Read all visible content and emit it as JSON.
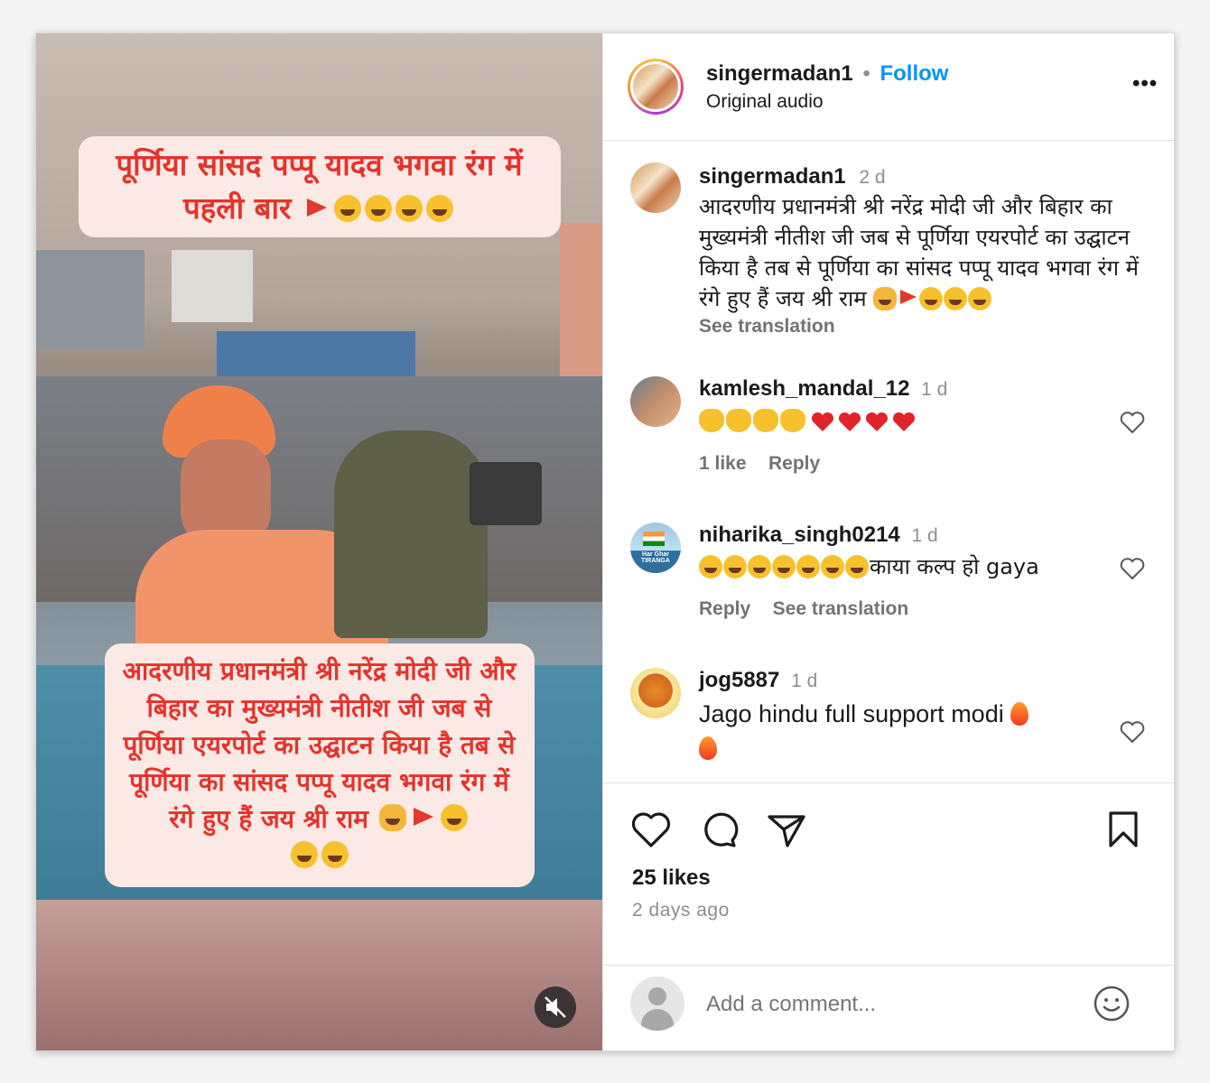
{
  "media": {
    "caption_top": "पूर्णिया सांसद पप्पू यादव भगवा रंग में पहली बार",
    "caption_bottom": "आदरणीय प्रधानमंत्री श्री नरेंद्र मोदी जी और बिहार का मुख्यमंत्री नीतीश जी जब से पूर्णिया एयरपोर्ट का उद्घाटन किया है तब से पूर्णिया का सांसद पप्पू यादव भगवा रंग में रंगे हुए हैं जय श्री राम",
    "mute_icon": "muted-speaker-icon"
  },
  "header": {
    "username": "singermadan1",
    "separator": "•",
    "follow_label": "Follow",
    "audio_label": "Original audio",
    "more_icon": "•••"
  },
  "post": {
    "username": "singermadan1",
    "time": "2 d",
    "text": "आदरणीय प्रधानमंत्री श्री नरेंद्र मोदी जी और बिहार का मुख्यमंत्री नीतीश जी जब से पूर्णिया एयरपोर्ट का उद्घाटन किया है तब से पूर्णिया का सांसद पप्पू यादव भगवा रंग में रंगे हुए हैं जय श्री राम",
    "see_translation": "See translation"
  },
  "comments": [
    {
      "username": "kamlesh_mandal_12",
      "time": "1 d",
      "text": "",
      "likes": "1 like",
      "reply": "Reply"
    },
    {
      "username": "niharika_singh0214",
      "time": "1 d",
      "text": "काया कल्प हो gaya",
      "avatar_text": "Har Ghar TIRANGA",
      "reply": "Reply",
      "see_translation": "See translation"
    },
    {
      "username": "jog5887",
      "time": "1 d",
      "text": "Jago hindu full support modi"
    }
  ],
  "footer": {
    "likes": "25 likes",
    "date": "2 days ago",
    "comment_placeholder": "Add a comment..."
  },
  "colors": {
    "follow_blue": "#0095f6",
    "caption_red": "#e5332a",
    "caption_bg": "#fbe9e6"
  }
}
